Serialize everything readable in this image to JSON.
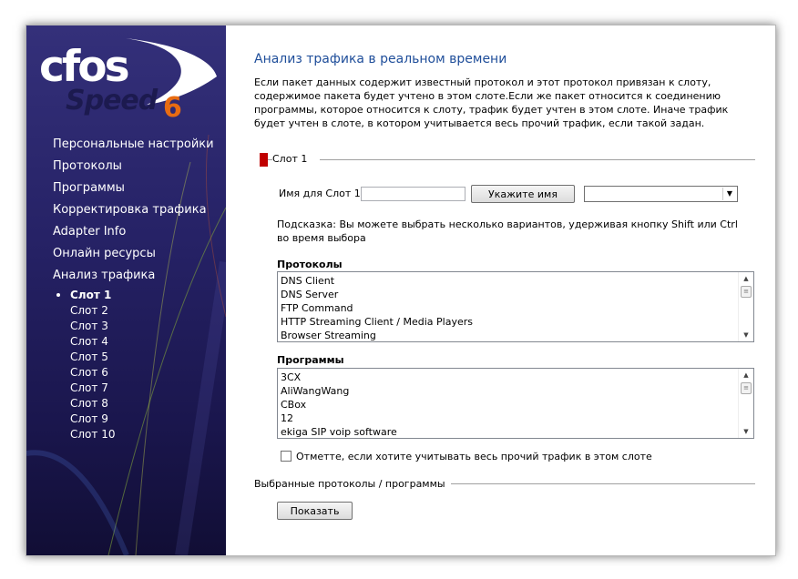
{
  "logo": {
    "brand_main": "cfos",
    "brand_sub": "Speed",
    "brand_version": "6",
    "colors": {
      "white": "#ffffff",
      "orange": "#e86c12",
      "navy": "#1c1a4f"
    }
  },
  "sidebar": {
    "items": [
      {
        "label": "Персональные настройки"
      },
      {
        "label": "Протоколы"
      },
      {
        "label": "Программы"
      },
      {
        "label": "Корректировка трафика"
      },
      {
        "label": "Adapter Info"
      },
      {
        "label": "Онлайн ресурсы"
      },
      {
        "label": "Анализ трафика"
      }
    ],
    "slots": [
      {
        "label": "Слот 1",
        "active": true
      },
      {
        "label": "Слот 2"
      },
      {
        "label": "Слот 3"
      },
      {
        "label": "Слот 4"
      },
      {
        "label": "Слот 5"
      },
      {
        "label": "Слот 6"
      },
      {
        "label": "Слот 7"
      },
      {
        "label": "Слот 8"
      },
      {
        "label": "Слот 9"
      },
      {
        "label": "Слот 10"
      }
    ]
  },
  "main": {
    "title": "Анализ трафика в реальном времени",
    "description": "Если пакет данных содержит известный протокол и этот протокол привязан к слоту, содержимое пакета будет учтено в этом слоте.Если же пакет относится к соединению программы, которое относится к слоту, трафик будет учтен в этом слоте. Иначе трафик будет учтен в слоте, в котором учитывается весь прочий трафик, если такой задан.",
    "slot_legend": "Слот 1",
    "slot_color": "#c00000",
    "name_label": "Имя для Слот 1",
    "name_input_value": "",
    "name_button": "Укажите имя",
    "name_select_value": "",
    "hint": "Подсказка: Вы можете выбрать несколько вариантов, удерживая кнопку Shift или Ctrl во время выбора",
    "protocols_label": "Протоколы",
    "protocols": [
      "DNS Client",
      "DNS Server",
      "FTP Command",
      "HTTP Streaming Client / Media Players",
      "Browser Streaming"
    ],
    "programs_label": "Программы",
    "programs": [
      "3CX",
      "AliWangWang",
      "CBox",
      "12",
      "ekiga SIP voip software"
    ],
    "other_traffic_checkbox": "Отметте, если хотите учитывать весь прочий трафик в этом слоте",
    "other_traffic_checked": false,
    "selected_label": "Выбранные протоколы / программы",
    "show_button": "Показать",
    "title_color": "#1f4e9a"
  }
}
